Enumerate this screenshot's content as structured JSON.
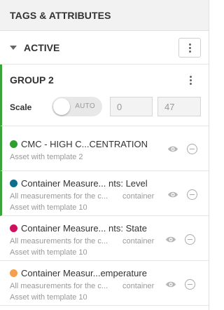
{
  "panel": {
    "title": "TAGS & ATTRIBUTES"
  },
  "section": {
    "title": "ACTIVE",
    "menu_icon": "more-vertical-icon"
  },
  "group": {
    "title": "GROUP 2",
    "scale_label": "Scale",
    "toggle_label": "AUTO",
    "toggle_on": false,
    "min_value": "0",
    "max_value": "47"
  },
  "assets": [
    {
      "title": "CMC - HIGH C...CENTRATION",
      "subtitle": "Asset with template 2",
      "color": "#2e9e2e"
    },
    {
      "title": "Container Measure...  nts: Level",
      "desc": "All measurements for the c...",
      "desc_right": "container",
      "subtitle": "Asset with template 10",
      "color": "#0d6e8e"
    },
    {
      "title": "Container Measure...  nts: State",
      "desc": "All measurements for the c...",
      "desc_right": "container",
      "subtitle": "Asset with template 10",
      "color": "#d0105d"
    },
    {
      "title": "Container Measur...emperature",
      "desc": "All measurements for the c...",
      "desc_right": "container",
      "subtitle": "Asset with template 10",
      "color": "#f5a04a"
    }
  ],
  "colors": {
    "active_bar": "#3aa33a",
    "header_bg": "#f2f2f2"
  }
}
